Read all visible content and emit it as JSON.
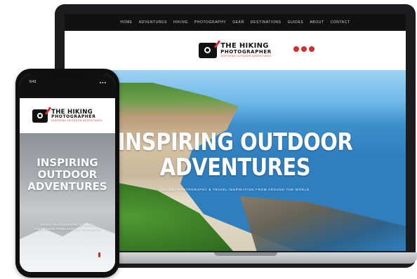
{
  "laptop": {
    "nav": {
      "items": [
        "Home",
        "Adventures",
        "Hiking",
        "Photography",
        "Gear",
        "Destinations",
        "Guides",
        "About",
        "Contact"
      ]
    },
    "brand": {
      "line1": "THE HIKING",
      "line2": "PHOTOGRAPHER",
      "line3": "INSPIRING OUTDOOR ADVENTURES",
      "accent_color": "#d92c2c",
      "icon": "camera-logo-icon"
    },
    "social_icons": [
      "facebook-icon",
      "instagram-icon",
      "youtube-icon"
    ],
    "hero": {
      "title_line1": "INSPIRING OUTDOOR",
      "title_line2": "ADVENTURES",
      "subtitle": "Hiking, photography & travel inspiration from around the world"
    }
  },
  "phone": {
    "status": {
      "time": "9:41",
      "indicators": "●●●"
    },
    "brand": {
      "line1": "THE HIKING",
      "line2": "PHOTOGRAPHER",
      "line3": "INSPIRING OUTDOOR ADVENTURES"
    },
    "hero": {
      "title_line1": "INSPIRING",
      "title_line2": "OUTDOOR",
      "title_line3": "ADVENTURES",
      "subtitle": "Hiking, photography & travel inspiration from around the world"
    }
  }
}
